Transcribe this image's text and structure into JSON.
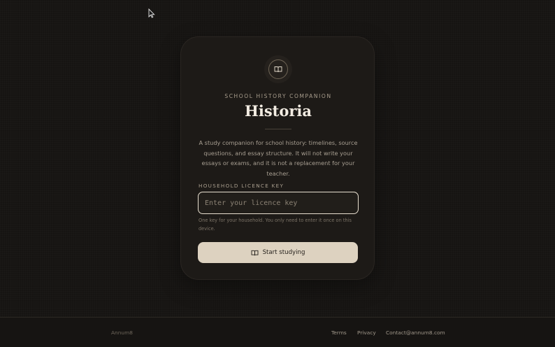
{
  "card": {
    "eyebrow": "SCHOOL HISTORY COMPANION",
    "title": "Historia",
    "description": "A study companion for school history: timelines, source questions, and essay structure. It will not write your essays or exams, and it is not a replacement for your teacher.",
    "logo_icon": "open-book-icon"
  },
  "licence": {
    "label": "HOUSEHOLD LICENCE KEY",
    "value": "",
    "placeholder": "Enter your licence key",
    "hint": "One key for your household. You only need to enter it once on this device."
  },
  "start_button": {
    "label": "Start studying",
    "icon": "open-book-icon"
  },
  "footer": {
    "brand": "Annum8",
    "links": [
      "Terms",
      "Privacy",
      "Contact@annum8.com"
    ]
  },
  "colors": {
    "background": "#161412",
    "card": "#1d1a17",
    "button": "#ddd2c0",
    "input_border": "#e8dfd0"
  }
}
